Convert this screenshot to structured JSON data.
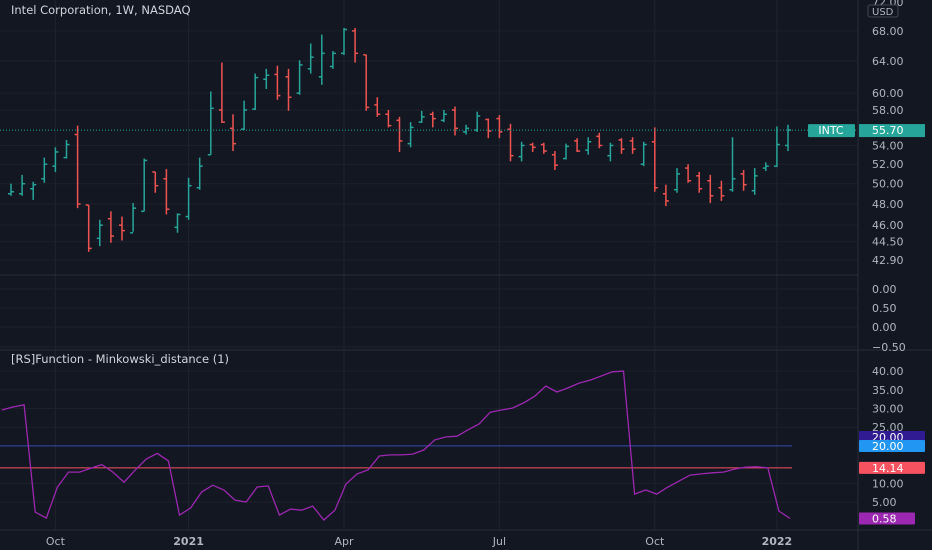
{
  "header": {
    "title": "Intel Corporation, 1W, NASDAQ",
    "currency": "USD",
    "top_cut_label": "72.00"
  },
  "indicator": {
    "title": "[RS]Function - Minkowski_distance (1)"
  },
  "price_axis": {
    "labels": [
      "68.00",
      "64.00",
      "60.00",
      "58.00",
      "54.00",
      "52.00",
      "50.00",
      "48.00",
      "46.00",
      "44.50",
      "42.90"
    ],
    "values": [
      68,
      64,
      60,
      58,
      54,
      52,
      50,
      48,
      46,
      44.5,
      42.9
    ]
  },
  "mid_axis": {
    "labels": [
      "0.00",
      "0.50",
      "0.00",
      "−0.50"
    ]
  },
  "ind_axis": {
    "labels": [
      "40.00",
      "35.00",
      "30.00",
      "25.00",
      "10.00",
      "5.00"
    ],
    "values": [
      40,
      35,
      30,
      25,
      10,
      5
    ]
  },
  "last_price": {
    "symbol": "INTC",
    "value": "55.70",
    "price": 55.7,
    "color": "#26a69a"
  },
  "ind_badges": [
    {
      "text": "20.00",
      "value": 20,
      "color": "#311b92"
    },
    {
      "text": "20.00",
      "value": 20,
      "color": "#2196f3"
    },
    {
      "text": "14.14",
      "value": 14.14,
      "color": "#f7525f"
    },
    {
      "text": "0.58",
      "value": 0.58,
      "color": "#9c27b0"
    }
  ],
  "time_axis": {
    "labels": [
      "Oct",
      "2021",
      "Apr",
      "Jul",
      "Oct",
      "2022"
    ],
    "bar_index": [
      4,
      16,
      30,
      44,
      58,
      69
    ]
  },
  "colors": {
    "up": "#26a69a",
    "down": "#ef5350",
    "line": "#9c27b0",
    "upper_level": "#3949ab",
    "lower_level": "#f7525f",
    "bg": "#131722"
  },
  "chart_data": [
    {
      "type": "bar",
      "style": "ohlc",
      "title": "Intel Corporation, 1W, NASDAQ",
      "ylabel": "USD",
      "yscale": "log",
      "ylim": [
        41.5,
        72
      ],
      "ohlc": [
        [
          49.0,
          50.0,
          48.8,
          49.2
        ],
        [
          49.0,
          50.9,
          48.8,
          50.0
        ],
        [
          49.5,
          50.2,
          48.4,
          49.9
        ],
        [
          50.5,
          52.7,
          50.1,
          52.0
        ],
        [
          51.8,
          53.8,
          51.2,
          53.3
        ],
        [
          52.7,
          54.6,
          52.6,
          54.1
        ],
        [
          55.2,
          56.2,
          47.6,
          48.0
        ],
        [
          47.9,
          47.9,
          43.6,
          43.9
        ],
        [
          44.8,
          46.5,
          44.1,
          46.0
        ],
        [
          46.6,
          47.3,
          44.4,
          45.0
        ],
        [
          46.0,
          46.8,
          44.6,
          45.5
        ],
        [
          45.3,
          48.1,
          45.4,
          47.6
        ],
        [
          47.3,
          52.6,
          47.3,
          52.4
        ],
        [
          51.2,
          51.2,
          49.1,
          49.8
        ],
        [
          50.5,
          51.5,
          47.0,
          47.5
        ],
        [
          45.8,
          47.1,
          45.3,
          47.0
        ],
        [
          46.8,
          50.6,
          46.5,
          49.8
        ],
        [
          49.6,
          52.7,
          49.4,
          51.8
        ],
        [
          53.0,
          60.2,
          53.0,
          58.2
        ],
        [
          58.0,
          63.8,
          56.5,
          56.6
        ],
        [
          55.9,
          57.5,
          53.4,
          54.2
        ],
        [
          55.8,
          59.1,
          55.7,
          58.0
        ],
        [
          58.1,
          62.4,
          58.0,
          61.9
        ],
        [
          61.7,
          63.0,
          60.5,
          62.2
        ],
        [
          62.3,
          63.4,
          59.2,
          59.7
        ],
        [
          62.0,
          63.0,
          57.9,
          59.5
        ],
        [
          60.0,
          64.1,
          59.8,
          63.5
        ],
        [
          63.0,
          66.3,
          62.4,
          64.5
        ],
        [
          62.0,
          67.5,
          61.0,
          65.0
        ],
        [
          63.3,
          65.3,
          63.0,
          65.0
        ],
        [
          65.0,
          68.4,
          64.8,
          68.2
        ],
        [
          68.0,
          68.4,
          63.8,
          65.0
        ],
        [
          64.8,
          64.8,
          57.9,
          58.3
        ],
        [
          58.6,
          59.5,
          57.2,
          57.5
        ],
        [
          57.5,
          58.0,
          56.0,
          56.2
        ],
        [
          56.8,
          57.2,
          53.3,
          54.5
        ],
        [
          54.2,
          56.6,
          53.8,
          56.0
        ],
        [
          56.6,
          57.9,
          56.5,
          57.2
        ],
        [
          57.5,
          57.8,
          56.0,
          57.0
        ],
        [
          56.8,
          58.0,
          56.6,
          57.5
        ],
        [
          58.0,
          58.4,
          55.1,
          55.9
        ],
        [
          55.5,
          56.3,
          55.2,
          55.9
        ],
        [
          55.7,
          57.8,
          55.5,
          57.3
        ],
        [
          56.9,
          57.0,
          54.8,
          55.6
        ],
        [
          57.0,
          57.4,
          54.8,
          55.5
        ],
        [
          55.8,
          56.4,
          52.3,
          52.9
        ],
        [
          52.8,
          54.4,
          52.3,
          54.0
        ],
        [
          54.1,
          54.3,
          53.3,
          53.8
        ],
        [
          54.1,
          54.3,
          53.1,
          53.4
        ],
        [
          53.0,
          53.4,
          51.4,
          51.9
        ],
        [
          52.6,
          54.2,
          52.5,
          53.9
        ],
        [
          54.5,
          54.8,
          53.3,
          53.4
        ],
        [
          53.5,
          54.9,
          53.0,
          54.4
        ],
        [
          55.0,
          55.4,
          53.7,
          54.0
        ],
        [
          52.9,
          54.3,
          52.3,
          54.0
        ],
        [
          54.6,
          54.8,
          53.1,
          53.6
        ],
        [
          54.5,
          54.9,
          53.1,
          53.6
        ],
        [
          52.0,
          54.4,
          51.8,
          54.1
        ],
        [
          54.4,
          56.0,
          49.2,
          49.6
        ],
        [
          49.0,
          49.9,
          47.8,
          48.3
        ],
        [
          49.4,
          51.6,
          49.1,
          51.0
        ],
        [
          51.6,
          52.0,
          50.1,
          50.3
        ],
        [
          50.8,
          51.2,
          49.1,
          49.5
        ],
        [
          50.3,
          50.9,
          48.1,
          48.8
        ],
        [
          49.6,
          50.3,
          48.3,
          48.8
        ],
        [
          49.4,
          54.9,
          49.2,
          50.5
        ],
        [
          51.0,
          51.4,
          49.3,
          49.9
        ],
        [
          49.3,
          51.6,
          48.9,
          50.8
        ],
        [
          51.6,
          52.2,
          51.3,
          51.8
        ],
        [
          51.8,
          56.1,
          51.7,
          54.1
        ],
        [
          54.0,
          56.3,
          53.4,
          55.7
        ]
      ]
    },
    {
      "type": "line",
      "title": "[RS]Function - Minkowski_distance (1)",
      "ylim": [
        -1.5,
        44
      ],
      "levels": [
        20,
        14.14
      ],
      "values": [
        29.6,
        30.4,
        31,
        2.3,
        0.7,
        9,
        13,
        13,
        14,
        15,
        13,
        10.3,
        13.5,
        16.5,
        18,
        16,
        1.5,
        3.4,
        7.7,
        9.5,
        8.2,
        5.5,
        5,
        9,
        9.3,
        1.5,
        3.1,
        2.8,
        3.9,
        0.2,
        2.8,
        9.8,
        12.5,
        13.6,
        17.3,
        17.6,
        17.6,
        17.8,
        18.9,
        21.6,
        22.4,
        22.6,
        24.3,
        25.9,
        29,
        29.6,
        30.1,
        31.5,
        33.3,
        36,
        34.4,
        35.5,
        36.8,
        37.6,
        38.7,
        39.8,
        40,
        7.1,
        8.2,
        7.1,
        9,
        10.6,
        12.2,
        12.5,
        12.8,
        13,
        13.8,
        14.3,
        14.4,
        14.14,
        2.6,
        0.58
      ]
    }
  ]
}
